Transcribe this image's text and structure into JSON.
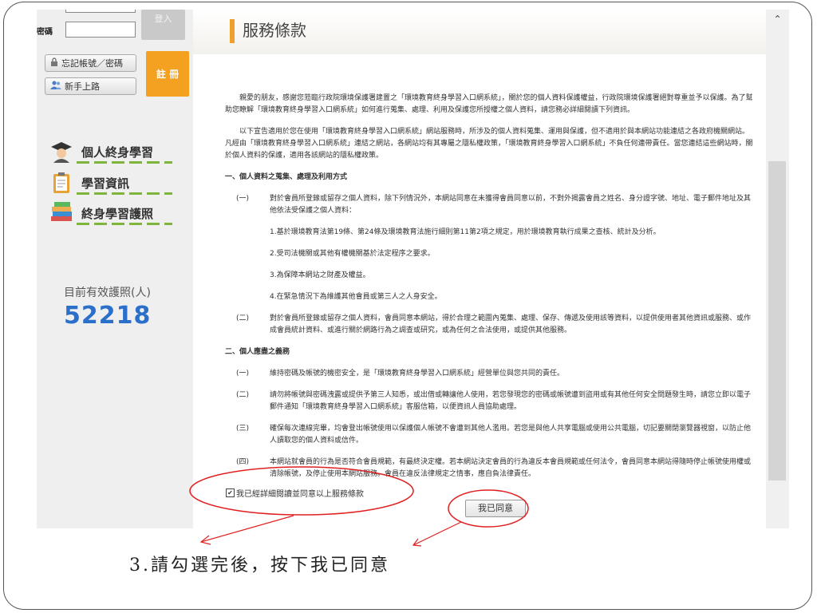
{
  "sidebar": {
    "password_label": "密碼",
    "login_button": "登入",
    "forgot_button": "忘記帳號／密碼",
    "newbie_button": "新手上路",
    "register_button": "註 冊",
    "menu": [
      {
        "label": "個人終身學習",
        "icon": "graduate-icon"
      },
      {
        "label": "學習資訊",
        "icon": "clipboard-icon"
      },
      {
        "label": "終身學習護照",
        "icon": "books-icon"
      }
    ],
    "counter_label": "目前有效護照(人)",
    "counter_value": "52218"
  },
  "main": {
    "title": "服務條款",
    "intro_1": "親愛的朋友，感謝您蒞臨行政院環境保護署建置之「環境教育終身學習入口網系統」，關於您的個人資料保護權益，行政院環境保護署絕對尊重並予以保護。為了幫助您瞭解「環境教育終身學習入口網系統」如何進行蒐集、處理、利用及保護您所授權之個人資料，請您務必詳細閱讀下列資訊。",
    "intro_2": "以下宣告適用於您在使用「環境教育終身學習入口網系統」網站服務時，所涉及的個人資料蒐集、運用與保護，但不適用於與本網站功能連結之各政府機關網站。凡經由「環境教育終身學習入口網系統」連結之網站，各網站均有其專屬之隱私權政策，「環境教育終身學習入口網系統」不負任何連帶責任。當您連結這些網站時，關於個人資料的保護，適用各該網站的隱私權政策。",
    "section1_title": "一、個人資料之蒐集、處理及利用方式",
    "s1_item1_num": "(一)",
    "s1_item1": "對於會員所登錄或留存之個人資料，除下列情況外，本網站同意在未獲得會員同意以前，不對外揭露會員之姓名、身分證字號、地址、電子郵件地址及其他依法受保護之個人資料：",
    "s1_sub1": "1.基於環境教育法第19條、第24條及環境教育法施行細則第11第2項之規定，用於環境教育執行成果之查核、統計及分析。",
    "s1_sub2": "2.受司法機關或其他有權機關基於法定程序之要求。",
    "s1_sub3": "3.為保障本網站之財產及權益。",
    "s1_sub4": "4.在緊急情況下為維護其他會員或第三人之人身安全。",
    "s1_item2_num": "(二)",
    "s1_item2": "對於會員所登錄或留存之個人資料，會員同意本網站，得於合理之範圍內蒐集、處理、保存、傳遞及使用該等資料，以提供使用者其他資訊或服務、或作成會員統計資料、或進行關於網路行為之調查或研究，或為任何之合法使用，或提供其他服務。",
    "section2_title": "二、個人應盡之義務",
    "s2_item1_num": "(一)",
    "s2_item1": "維持密碼及帳號的機密安全，是「環境教育終身學習入口網系統」經營單位與您共同的責任。",
    "s2_item2_num": "(二)",
    "s2_item2": "請勿將帳號與密碼洩露或提供予第三人知悉，或出借或轉讓他人使用，若您發現您的密碼或帳號遭到盜用或有其他任何安全問題發生時，請您立即以電子郵件通知「環境教育終身學習入口網系統」客服信箱，以便資訊人員協助處理。",
    "s2_item3_num": "(三)",
    "s2_item3": "確保每次連線完畢，均會登出帳號使用以保護個人帳號不會遭到其他人濫用。若您是與他人共享電腦或使用公共電腦，切記要關閉瀏覽器視窗，以防止他人讀取您的個人資料或信件。",
    "s2_item4_num": "(四)",
    "s2_item4": "本網站就會員的行為是否符合會員規範，有最終決定權。若本網站決定會員的行為違反本會員規範或任何法令，會員同意本網站得隨時停止帳號使用權或清除帳號，及停止使用本網站服務。會員在違反法律規定之情事，應自負法律責任。",
    "agree_checkbox_label": "我已經詳細閱讀並同意以上服務條款",
    "agree_checked": true,
    "agree_button": "我已同意"
  },
  "annotation": {
    "text": "3.請勾選完後，按下我已同意",
    "accent_color": "#e02020"
  }
}
